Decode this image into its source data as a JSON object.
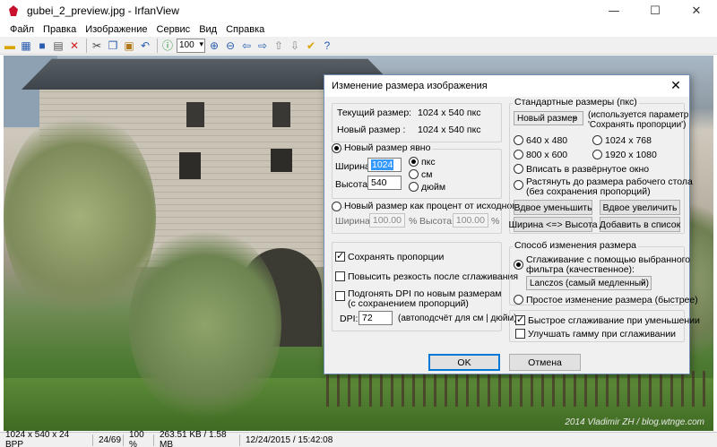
{
  "window": {
    "title": "gubei_2_preview.jpg - IrfanView"
  },
  "menu": [
    "Файл",
    "Правка",
    "Изображение",
    "Сервис",
    "Вид",
    "Справка"
  ],
  "toolbar": {
    "zoom_value": "100"
  },
  "image": {
    "watermark": "2014 Vladimir ZH / blog.wtnge.com"
  },
  "status": {
    "dims": "1024 x 540 x 24 BPP",
    "index": "24/69",
    "zoom": "100 %",
    "size": "263.51 KB / 1.58 MB",
    "datetime": "12/24/2015 / 15:42:08"
  },
  "dialog": {
    "title": "Изменение размера изображения",
    "current_size_label": "Текущий размер:",
    "current_size_value": "1024  x  540  пкс",
    "new_size_label": "Новый размер :",
    "new_size_value": "1024  x  540  пкс",
    "explicit_radio": "Новый размер явно",
    "width_label": "Ширина:",
    "width_value": "1024",
    "height_label": "Высота:",
    "height_value": "540",
    "unit_px": "пкс",
    "unit_cm": "см",
    "unit_inch": "дюйм",
    "percent_radio": "Новый размер как процент от исходного",
    "pct_width_label": "Ширина:",
    "pct_width_value": "100.00",
    "pct_height_label": "Высота:",
    "pct_height_value": "100.00",
    "pct_sign": "%",
    "keep_aspect": "Сохранять пропорции",
    "sharpen": "Повысить резкость после сглаживания",
    "adjust_dpi_line1": "Подгонять DPI по новым размерам",
    "adjust_dpi_line2": "(с сохранением пропорций)",
    "dpi_label": "DPI:",
    "dpi_value": "72",
    "dpi_note": "(автоподсчёт для см | дюйм)",
    "std_group": "Стандартные размеры (пкс)",
    "std_combo": "Новый размер",
    "std_note_line1": "(используется параметр",
    "std_note_line2": "'Сохранять пропорции')",
    "std_sizes": [
      "640 x 480",
      "1024 x 768",
      "800 x 600",
      "1920 x 1080"
    ],
    "fit_desktop": "Вписать в развёрнутое окно",
    "stretch_desktop_line1": "Растянуть до размера рабочего стола",
    "stretch_desktop_line2": "(без сохранения пропорций)",
    "btn_half": "Вдвое уменьшить",
    "btn_double": "Вдвое увеличить",
    "btn_swap": "Ширина <=> Высота",
    "btn_add": "Добавить в список",
    "method_group": "Способ изменения размера",
    "resample_line1": "Сглаживание с помощью выбранного",
    "resample_line2": "фильтра (качественное):",
    "filter_combo": "Lanczos (самый медленный)",
    "simple_resize": "Простое изменение размера (быстрее)",
    "fast_resample": "Быстрое сглаживание при уменьшении",
    "gamma": "Улучшать гамму при сглаживании",
    "ok": "OK",
    "cancel": "Отмена"
  }
}
